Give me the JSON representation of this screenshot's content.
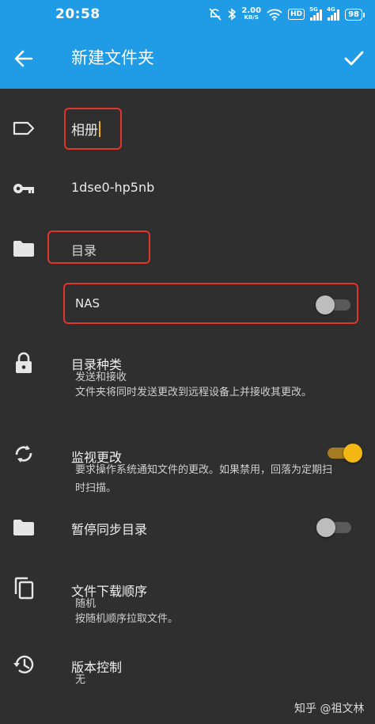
{
  "statusbar": {
    "time": "20:58",
    "speed_value": "2.00",
    "speed_unit": "KB/S",
    "hd_label": "HD",
    "signal1_tag": "5G",
    "signal2_tag": "4G",
    "battery": "98"
  },
  "appbar": {
    "title": "新建文件夹"
  },
  "folder": {
    "label_value": "相册",
    "id_value": "1dse0-hp5nb",
    "path_value": "目录",
    "nas_label": "NAS",
    "nas_switch": false
  },
  "folder_type": {
    "title": "目录种类",
    "value": "发送和接收",
    "description": "文件夹将同时发送更改到远程设备上并接收其更改。"
  },
  "watch_changes": {
    "title": "监视更改",
    "description_line1": "要求操作系统通知文件的更改。如果禁用，回落为定期扫",
    "description_line2": "时扫描。",
    "enabled": true
  },
  "pause_sync": {
    "title": "暂停同步目录",
    "enabled": false
  },
  "pull_order": {
    "title": "文件下载顺序",
    "value": "随机",
    "description": "按随机顺序拉取文件。"
  },
  "versioning": {
    "title": "版本控制",
    "value": "无"
  },
  "watermark": "知乎 @祖文林",
  "colors": {
    "accent": "#1f9ce5",
    "background": "#2f2f2f",
    "highlight": "#e2352b",
    "switch_on": "#f4b714"
  },
  "icons": {
    "back": "arrow-left-icon",
    "confirm": "check-icon",
    "label": "label-tag-icon",
    "id": "key-icon",
    "path": "folder-icon",
    "type": "lock-icon",
    "watch": "sync-icon",
    "pause": "folder-icon",
    "order": "copy-icon",
    "version": "history-icon"
  }
}
